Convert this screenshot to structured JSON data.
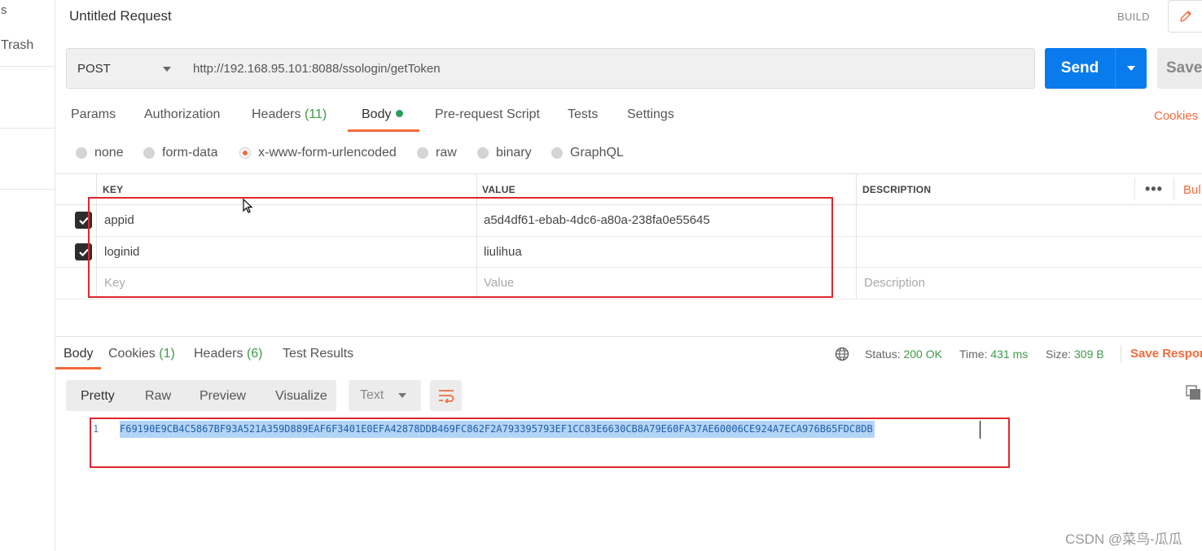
{
  "sidebar": {
    "partial_top": "s",
    "trash_label": "Trash"
  },
  "request": {
    "title": "Untitled Request",
    "build_label": "BUILD",
    "method": "POST",
    "url": "http://192.168.95.101:8088/ssologin/getToken",
    "send_label": "Send",
    "save_label": "Save"
  },
  "request_tabs": {
    "params": "Params",
    "authorization": "Authorization",
    "headers": "Headers",
    "headers_count": "(11)",
    "body": "Body",
    "pre_request": "Pre-request Script",
    "tests": "Tests",
    "settings": "Settings",
    "cookies": "Cookies"
  },
  "body_types": {
    "selected": "x-www-form-urlencoded",
    "none": "none",
    "form_data": "form-data",
    "urlencoded": "x-www-form-urlencoded",
    "raw": "raw",
    "binary": "binary",
    "graphql": "GraphQL"
  },
  "params_table": {
    "headers": {
      "key": "KEY",
      "value": "VALUE",
      "description": "DESCRIPTION"
    },
    "bulk_edit": "Bul",
    "rows": [
      {
        "checked": true,
        "key": "appid",
        "value": "a5d4df61-ebab-4dc6-a80a-238fa0e55645"
      },
      {
        "checked": true,
        "key": "loginid",
        "value": "liulihua"
      }
    ],
    "placeholder": {
      "key": "Key",
      "value": "Value",
      "description": "Description"
    }
  },
  "response": {
    "tabs": {
      "body": "Body",
      "cookies": "Cookies",
      "cookies_count": "(1)",
      "headers": "Headers",
      "headers_count": "(6)",
      "test_results": "Test Results"
    },
    "status_label": "Status:",
    "status_value": "200 OK",
    "time_label": "Time:",
    "time_value": "431 ms",
    "size_label": "Size:",
    "size_value": "309 B",
    "save_response": "Save Respor",
    "views": {
      "pretty": "Pretty",
      "raw": "Raw",
      "preview": "Preview",
      "visualize": "Visualize"
    },
    "format": "Text",
    "line_number": "1",
    "body_text": "F69190E9CB4C5867BF93A521A359D889EAF6F3401E0EFA42878DDB469FC862F2A793395793EF1CC83E6630CB8A79E60FA37AE60006CE924A7ECA976B65FDC8DB"
  },
  "watermark": "CSDN @菜鸟-瓜瓜",
  "colors": {
    "accent": "#f26b3a",
    "send_blue": "#097bed",
    "success_green": "#3d9a48",
    "annotation_red": "#e0262d"
  }
}
